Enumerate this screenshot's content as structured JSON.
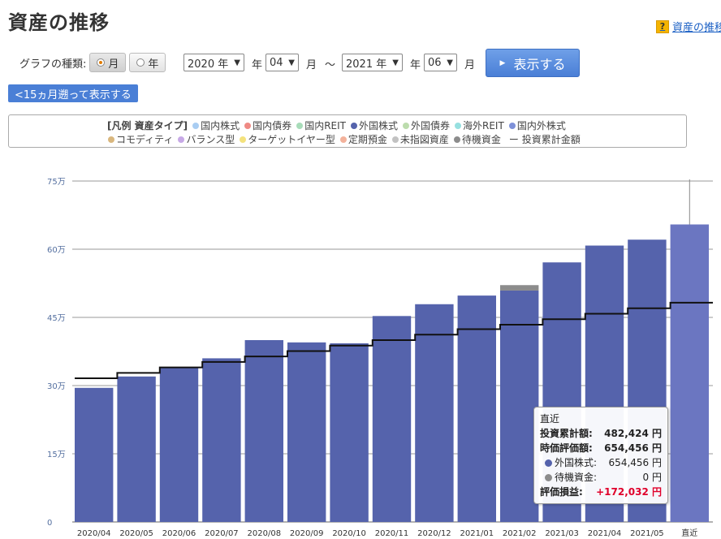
{
  "page": {
    "title": "資産の推移",
    "help_link": "資産の推移",
    "help_icon_char": "?"
  },
  "controls": {
    "graph_type_label": "グラフの種類:",
    "option_month": "月",
    "option_year": "年",
    "selected_option": "月",
    "from_year": "2020 年",
    "year_unit_1": "年",
    "from_month": "04",
    "month_unit_1": "月",
    "range_sep": "～",
    "to_year": "2021 年",
    "year_unit_2": "年",
    "to_month": "06",
    "month_unit_2": "月",
    "show_button": "表示する",
    "back_button": "<15ヵ月遡って表示する"
  },
  "legend": {
    "title": "[凡例 資産タイプ]",
    "row1": [
      {
        "label": "国内株式",
        "color": "#a9cdf2"
      },
      {
        "label": "国内債券",
        "color": "#ef8a84"
      },
      {
        "label": "国内REIT",
        "color": "#a8dcb9"
      },
      {
        "label": "外国株式",
        "color": "#5563ac"
      },
      {
        "label": "外国債券",
        "color": "#bcdcad"
      },
      {
        "label": "海外REIT",
        "color": "#97e0e0"
      },
      {
        "label": "国内外株式",
        "color": "#7d90d8"
      }
    ],
    "row2": [
      {
        "label": "コモディティ",
        "color": "#d9b77e"
      },
      {
        "label": "バランス型",
        "color": "#c7a9e6"
      },
      {
        "label": "ターゲットイヤー型",
        "color": "#f4e27d"
      },
      {
        "label": "定期預金",
        "color": "#f3b29b"
      },
      {
        "label": "未指図資産",
        "color": "#c2c2c2"
      },
      {
        "label": "待機資金",
        "color": "#8c8c8c"
      }
    ],
    "line_item": "ー 投資累計金額"
  },
  "chart_data": {
    "type": "bar",
    "categories": [
      "2020/04",
      "2020/05",
      "2020/06",
      "2020/07",
      "2020/08",
      "2020/09",
      "2020/10",
      "2020/11",
      "2020/12",
      "2021/01",
      "2021/02",
      "2021/03",
      "2021/04",
      "2021/05",
      "直近"
    ],
    "y_tick_labels": [
      "0",
      "15万",
      "30万",
      "45万",
      "60万",
      "75万"
    ],
    "ylim": [
      0,
      750000
    ],
    "series": [
      {
        "name": "外国株式",
        "color": "#5563ac",
        "values": [
          295000,
          320000,
          340000,
          360000,
          400000,
          395000,
          393000,
          453000,
          479000,
          498000,
          509000,
          571000,
          608000,
          621000,
          654456
        ]
      },
      {
        "name": "待機資金",
        "color": "#8c8c8c",
        "values": [
          0,
          0,
          0,
          0,
          0,
          0,
          0,
          0,
          0,
          0,
          12000,
          0,
          0,
          0,
          0
        ]
      }
    ],
    "line": {
      "name": "投資累計金額",
      "values": [
        316000,
        328000,
        340000,
        352000,
        364000,
        376000,
        388000,
        400000,
        412000,
        424000,
        434000,
        446000,
        458000,
        470000,
        482424
      ]
    },
    "highlight_index": 14,
    "highlight_color": "#6b76c1",
    "grid": true
  },
  "tooltip": {
    "title": "直近",
    "rows": [
      {
        "label": "投資累計額:",
        "value": "482,424 円",
        "bold": true
      },
      {
        "label": "時価評価額:",
        "value": "654,456 円",
        "bold": true
      },
      {
        "label": "外国株式:",
        "value": "654,456 円",
        "bold": false,
        "dot": "#5563ac"
      },
      {
        "label": "待機資金:",
        "value": "0 円",
        "bold": false,
        "dot": "#8c8c8c"
      },
      {
        "label": "評価損益:",
        "value": "+172,032 円",
        "bold": true,
        "profit": true
      }
    ]
  }
}
